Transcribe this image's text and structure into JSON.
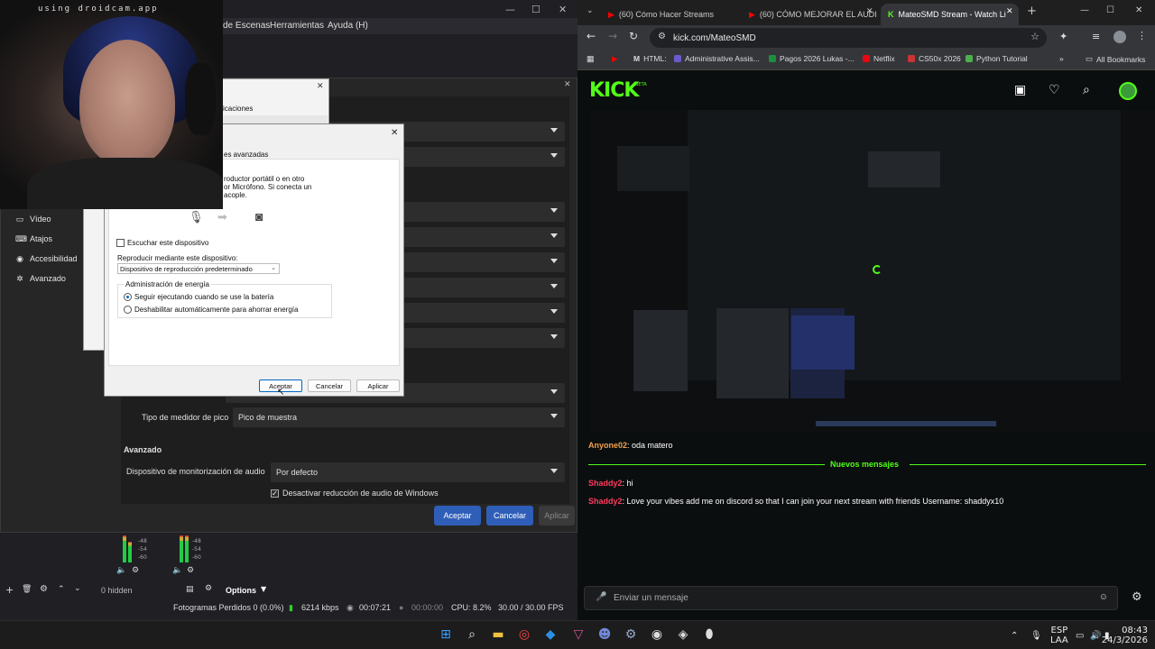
{
  "webcam": {
    "label": "using droidcam.app"
  },
  "obs": {
    "menus": [
      "de Escenas",
      "Herramientas",
      "Ayuda (H)"
    ],
    "nav": [
      {
        "label": "Vídeo",
        "icon": "monitor-icon"
      },
      {
        "label": "Atajos",
        "icon": "keyboard-icon"
      },
      {
        "label": "Accesibilidad",
        "icon": "accessibility-icon"
      },
      {
        "label": "Avanzado",
        "icon": "wrench-icon"
      }
    ],
    "peak_meter_label": "Tipo de medidor de pico",
    "peak_meter_value": "Pico de muestra",
    "advanced_heading": "Avanzado",
    "monitor_device_label": "Dispositivo de monitorización de audio",
    "monitor_device_value": "Por defecto",
    "ducking_label": "Desactivar reducción de audio de Windows",
    "buttons": {
      "ok": "Aceptar",
      "cancel": "Cancelar",
      "apply": "Aplicar"
    },
    "meter_ticks": [
      "-48",
      "-54",
      "-60"
    ],
    "hidden_count": "0 hidden",
    "options": "Options",
    "status": {
      "dropped": "Fotogramas Perdidos 0 (0.0%)",
      "bitrate": "6214 kbps",
      "live_time": "00:07:21",
      "rec_time": "00:00:00",
      "cpu": "CPU: 8.2%",
      "fps": "30.00 / 30.00 FPS"
    }
  },
  "win_dialog": {
    "back_fragment_1": "icaciones",
    "heading_fragment": "es avanzadas",
    "desc_line1": "roductor portátil o en otro",
    "desc_line2": "or Micrófono. Si conecta un",
    "desc_line3": "acople.",
    "listen_label": "Escuchar este dispositivo",
    "playback_label": "Reproducir mediante este dispositivo:",
    "playback_value": "Dispositivo de reproducción predeterminado",
    "power_group": "Administración de energía",
    "power_option1": "Seguir ejecutando cuando se use la batería",
    "power_option2": "Deshabilitar automáticamente para ahorrar energía",
    "ok": "Aceptar",
    "cancel": "Cancelar",
    "apply": "Aplicar"
  },
  "chrome": {
    "tabs": [
      {
        "title": "(60) Cómo Hacer Streams",
        "active": false
      },
      {
        "title": "(60) CÓMO MEJORAR EL AUDI",
        "active": false
      },
      {
        "title": "MateoSMD Stream - Watch Li",
        "active": true
      }
    ],
    "url": "kick.com/MateoSMD",
    "bookmarks": [
      {
        "label": "HTML:",
        "color": "#e33"
      },
      {
        "label": "Administrative Assis...",
        "color": "#6a5acd"
      },
      {
        "label": "Pagos 2026 Lukas -...",
        "color": "#1e8e3e"
      },
      {
        "label": "Netflix",
        "color": "#e50914"
      },
      {
        "label": "CS50x 2026",
        "color": "#c33"
      },
      {
        "label": "Python Tutorial",
        "color": "#4caf50"
      }
    ],
    "all_bookmarks": "All Bookmarks"
  },
  "kick": {
    "logo": "KICK",
    "logo_beta": "BETA",
    "new_messages": "Nuevos mensajes",
    "chat": [
      {
        "user": "Anyone02",
        "user_color": "#f0a050",
        "text": "oda matero"
      },
      {
        "user": "Shaddy2",
        "user_color": "#ff3b5c",
        "text": "hi"
      },
      {
        "user": "Shaddy2",
        "user_color": "#ff3b5c",
        "text": "Love your vibes add me on discord so that I can join your next stream with friends Username: shaddyx10"
      }
    ],
    "chat_placeholder": "Enviar un mensaje"
  },
  "taskbar": {
    "lang1": "ESP",
    "lang2": "LAA",
    "time": "08:43",
    "date": "24/3/2026"
  },
  "colors": {
    "kick_green": "#53fc18",
    "obs_blue": "#2f5eb8"
  }
}
